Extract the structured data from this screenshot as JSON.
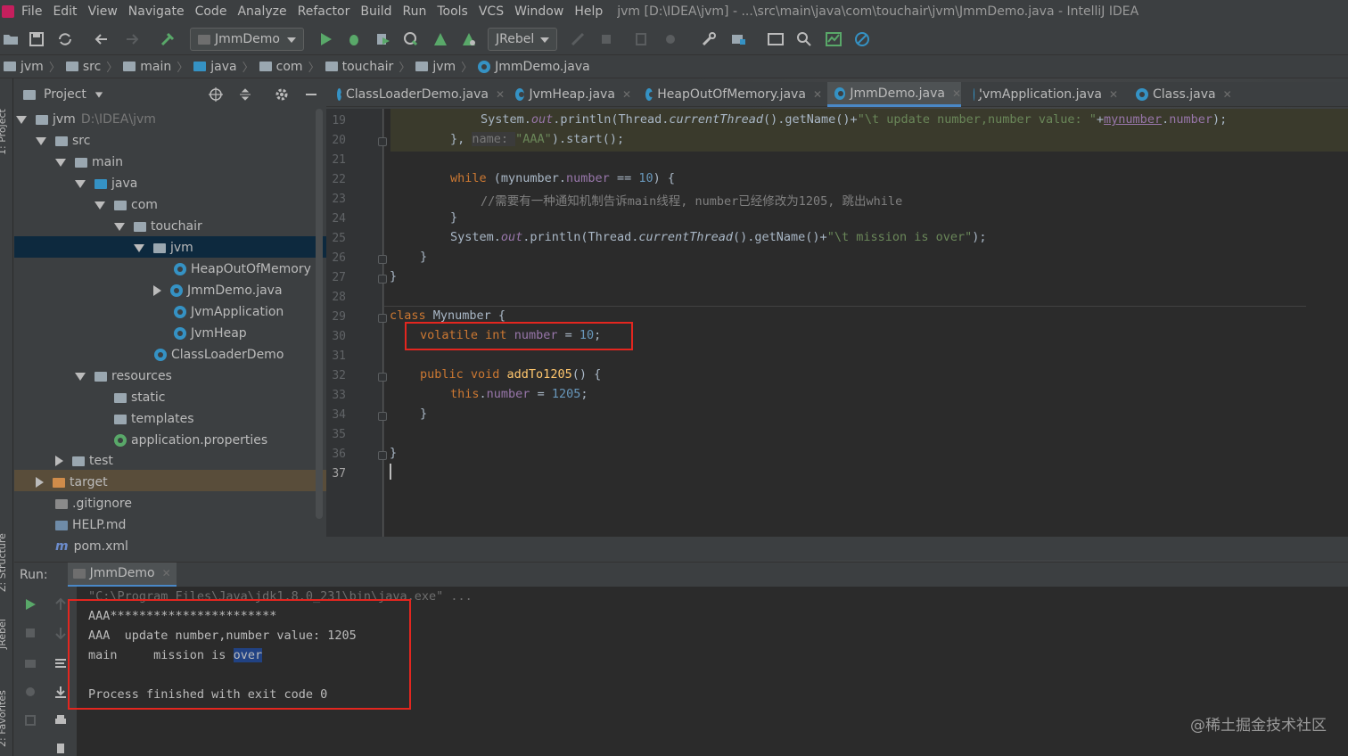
{
  "menubar": {
    "items": [
      "File",
      "Edit",
      "View",
      "Navigate",
      "Code",
      "Analyze",
      "Refactor",
      "Build",
      "Run",
      "Tools",
      "VCS",
      "Window",
      "Help"
    ],
    "title": "jvm [D:\\IDEA\\jvm] - ...\\src\\main\\java\\com\\touchair\\jvm\\JmmDemo.java - IntelliJ IDEA"
  },
  "toolbar": {
    "run_config": "JmmDemo",
    "jrebel": "JRebel"
  },
  "breadcrumb": [
    "jvm",
    "src",
    "main",
    "java",
    "com",
    "touchair",
    "jvm",
    "JmmDemo.java"
  ],
  "project": {
    "header": "Project",
    "tree": [
      {
        "label": "jvm",
        "extra": "D:\\IDEA\\jvm"
      },
      {
        "label": "src"
      },
      {
        "label": "main"
      },
      {
        "label": "java"
      },
      {
        "label": "com"
      },
      {
        "label": "touchair"
      },
      {
        "label": "jvm"
      },
      {
        "label": "HeapOutOfMemory"
      },
      {
        "label": "JmmDemo.java"
      },
      {
        "label": "JvmApplication"
      },
      {
        "label": "JvmHeap"
      },
      {
        "label": "ClassLoaderDemo"
      },
      {
        "label": "resources"
      },
      {
        "label": "static"
      },
      {
        "label": "templates"
      },
      {
        "label": "application.properties"
      },
      {
        "label": "test"
      },
      {
        "label": "target"
      },
      {
        "label": ".gitignore"
      },
      {
        "label": "HELP.md"
      },
      {
        "label": "pom.xml"
      }
    ]
  },
  "side_labels": {
    "project": "1: Project",
    "structure": "Z: Structure",
    "jrebel": "JRebel",
    "favorites": "2: Favorites"
  },
  "tabs": [
    "ClassLoaderDemo.java",
    "JvmHeap.java",
    "HeapOutOfMemory.java",
    "JmmDemo.java",
    "JvmApplication.java",
    "Class.java"
  ],
  "editor": {
    "line_numbers": [
      "19",
      "20",
      "21",
      "22",
      "23",
      "24",
      "25",
      "26",
      "27",
      "28",
      "29",
      "30",
      "31",
      "32",
      "33",
      "34",
      "35",
      "36",
      "37"
    ],
    "l19_a": "System.",
    "l19_b": "out",
    "l19_c": ".println(Thread.",
    "l19_d": "currentThread",
    "l19_e": "().getName()+",
    "l19_f": "\"\\t update number,number value: \"",
    "l19_g": "+",
    "l19_h": "mynumber",
    "l19_i": ".",
    "l19_j": "number",
    "l19_k": ");",
    "l20_a": "}, ",
    "l20_hint": "name: ",
    "l20_b": "\"AAA\"",
    "l20_c": ").start();",
    "l22_kw": "while",
    "l22_a": " (mynumber.",
    "l22_b": "number",
    "l22_c": " == ",
    "l22_d": "10",
    "l22_e": ") {",
    "l23": "//需要有一种通知机制告诉main线程, number已经修改为1205, 跳出while",
    "l24": "}",
    "l25_a": "System.",
    "l25_b": "out",
    "l25_c": ".println(Thread.",
    "l25_d": "currentThread",
    "l25_e": "().getName()+",
    "l25_f": "\"\\t mission is over\"",
    "l25_g": ");",
    "l26": "}",
    "l27": "}",
    "l29_kw": "class",
    "l29_a": " Mynumber {",
    "l30_kw": "volatile int",
    "l30_a": " ",
    "l30_b": "number",
    "l30_c": " = ",
    "l30_d": "10",
    "l30_e": ";",
    "l32_kw": "public void",
    "l32_a": " ",
    "l32_b": "addTo1205",
    "l32_c": "() {",
    "l33_kw": "this",
    "l33_a": ".",
    "l33_b": "number",
    "l33_c": " = ",
    "l33_d": "1205",
    "l33_e": ";",
    "l34": "}",
    "l36": "}"
  },
  "run": {
    "label": "Run:",
    "tab": "JmmDemo",
    "lines": [
      "\"C:\\Program Files\\Java\\jdk1.8.0_231\\bin\\java.exe\" ...",
      "AAA***********************",
      "AAA  update number,number value: 1205",
      "main     mission is ",
      "Process finished with exit code 0"
    ],
    "over": "over"
  },
  "watermark": "@稀土掘金技术社区",
  "colors": {
    "highlight_box": "#e3261f",
    "keyword": "#cc7832",
    "string": "#6a8759",
    "number": "#6897bb",
    "field": "#9876aa"
  }
}
